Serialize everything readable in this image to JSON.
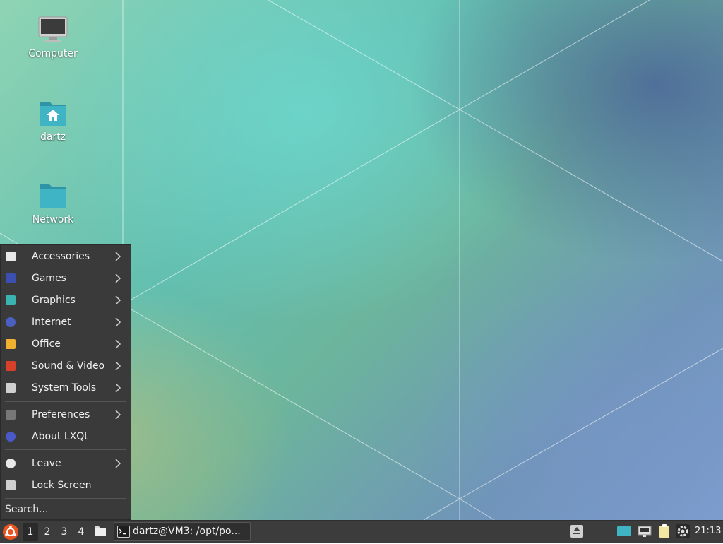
{
  "desktop": {
    "icons": [
      {
        "label": "Computer",
        "icon": "computer-icon"
      },
      {
        "label": "dartz",
        "icon": "home-folder-icon"
      },
      {
        "label": "Network",
        "icon": "network-folder-icon"
      }
    ]
  },
  "menu": {
    "items": [
      {
        "label": "Accessories",
        "icon": "accessories-icon",
        "submenu": true
      },
      {
        "label": "Games",
        "icon": "games-icon",
        "submenu": true
      },
      {
        "label": "Graphics",
        "icon": "graphics-icon",
        "submenu": true
      },
      {
        "label": "Internet",
        "icon": "internet-icon",
        "submenu": true
      },
      {
        "label": "Office",
        "icon": "office-icon",
        "submenu": true
      },
      {
        "label": "Sound & Video",
        "icon": "sound-video-icon",
        "submenu": true
      },
      {
        "label": "System Tools",
        "icon": "system-tools-icon",
        "submenu": true
      },
      {
        "label": "Preferences",
        "icon": "preferences-icon",
        "submenu": true
      },
      {
        "label": "About LXQt",
        "icon": "about-icon",
        "submenu": false
      },
      {
        "label": "Leave",
        "icon": "power-icon",
        "submenu": true
      },
      {
        "label": "Lock Screen",
        "icon": "lock-screen-icon",
        "submenu": false
      }
    ],
    "search_placeholder": "Search..."
  },
  "taskbar": {
    "workspaces": [
      "1",
      "2",
      "3",
      "4"
    ],
    "active_workspace": "1",
    "task_label": "dartz@VM3: /opt/po...",
    "clock": "21:13"
  },
  "colors": {
    "panel": "#3c3c3c",
    "menu_bg": "#3a3a3a",
    "folder_teal": "#3fb4c4",
    "start_orange": "#e95420"
  }
}
